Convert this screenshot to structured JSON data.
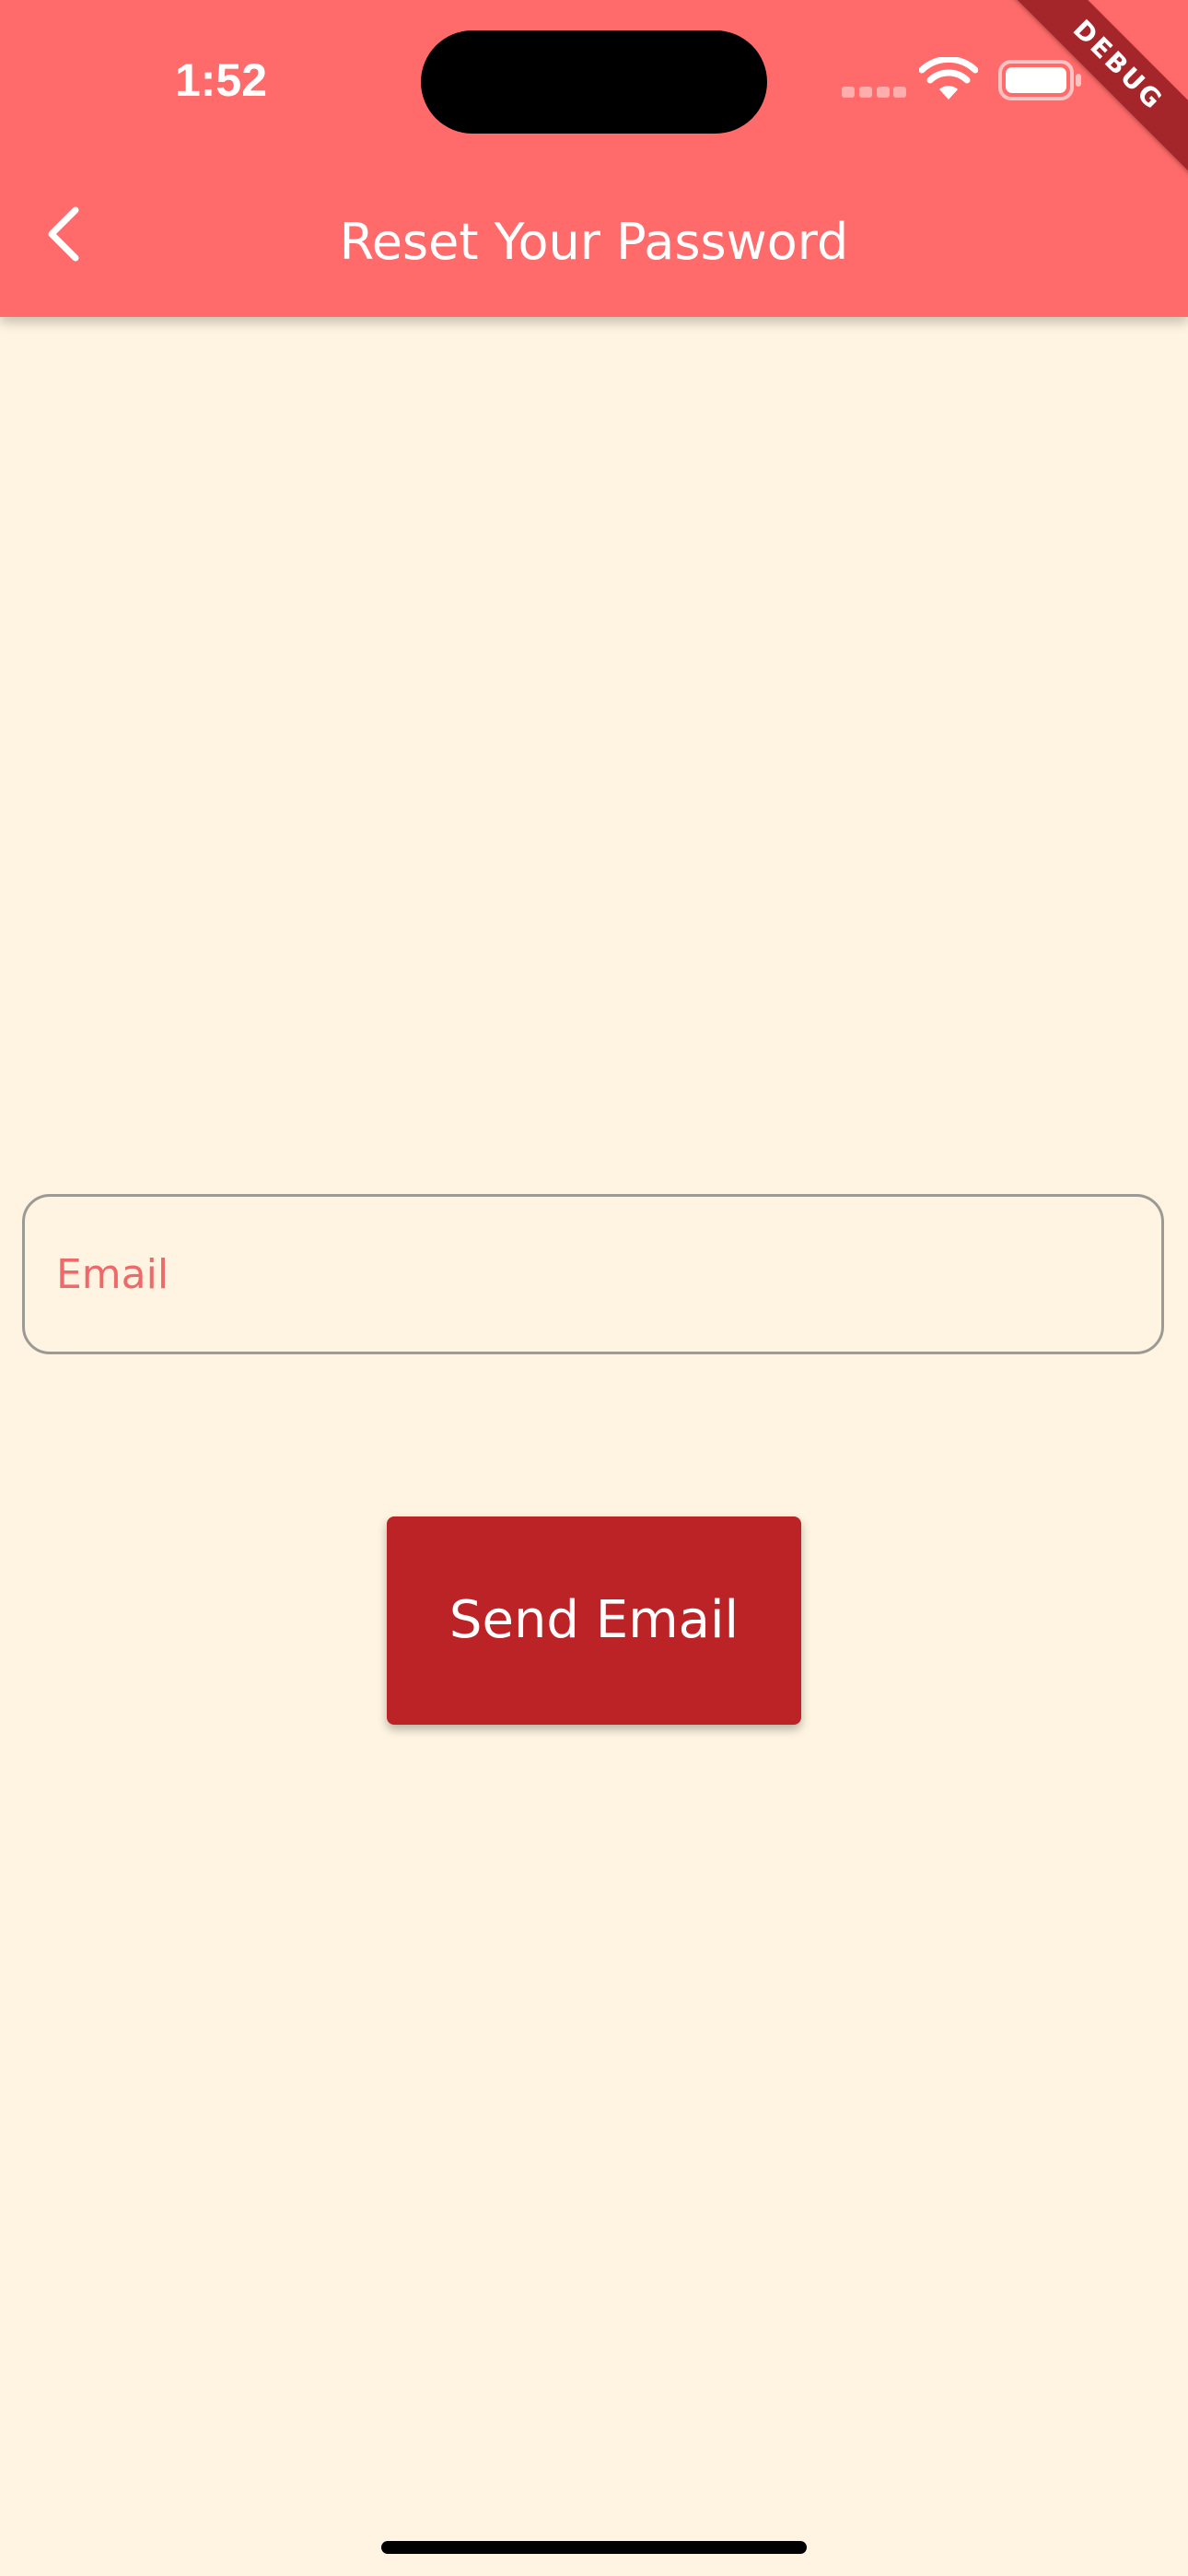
{
  "status_bar": {
    "time": "1:52"
  },
  "debug_banner": {
    "label": "DEBUG"
  },
  "app_bar": {
    "title": "Reset Your Password",
    "back_icon": "chevron-left-icon",
    "background_color": "#FF6A6A"
  },
  "form": {
    "email_placeholder": "Email",
    "email_value": "",
    "send_button_label": "Send Email",
    "send_button_color": "#BB2327"
  },
  "theme": {
    "page_background": "#FEF4E1",
    "placeholder_color": "#EE6A6A"
  }
}
